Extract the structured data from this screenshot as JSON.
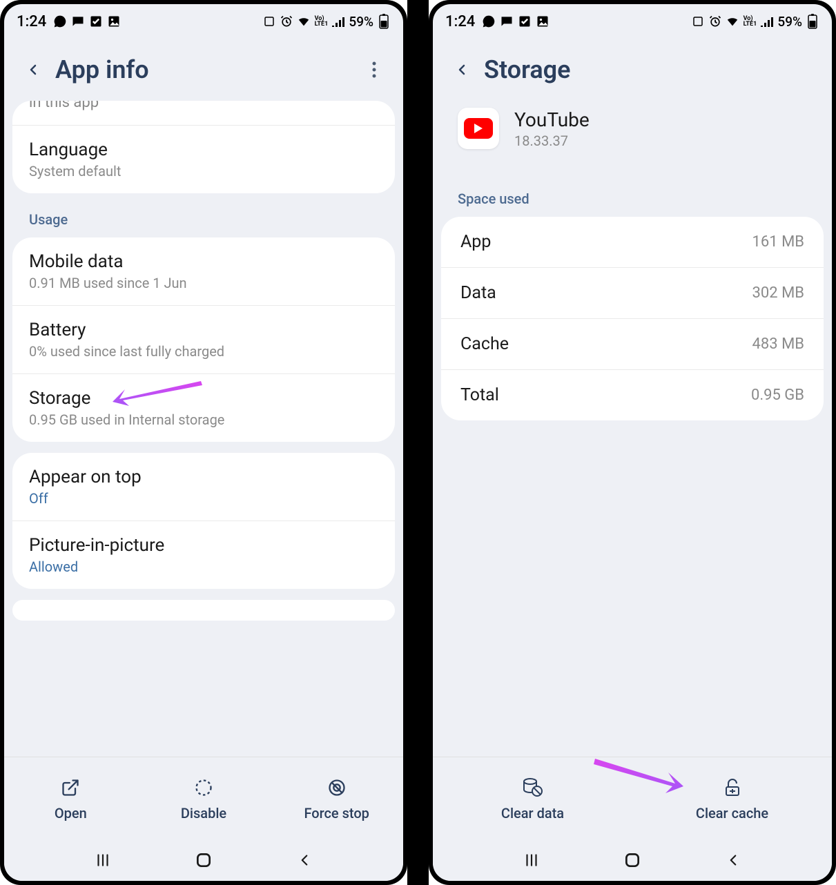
{
  "status": {
    "time": "1:24",
    "battery": "59%"
  },
  "left": {
    "header": "App info",
    "cut_text": "in this app",
    "language": {
      "title": "Language",
      "sub": "System default"
    },
    "usage_label": "Usage",
    "mobile_data": {
      "title": "Mobile data",
      "sub": "0.91 MB used since 1 Jun"
    },
    "battery": {
      "title": "Battery",
      "sub": "0% used since last fully charged"
    },
    "storage": {
      "title": "Storage",
      "sub": "0.95 GB used in Internal storage"
    },
    "appear": {
      "title": "Appear on top",
      "sub": "Off"
    },
    "pip": {
      "title": "Picture-in-picture",
      "sub": "Allowed"
    },
    "buttons": {
      "open": "Open",
      "disable": "Disable",
      "force_stop": "Force stop"
    }
  },
  "right": {
    "header": "Storage",
    "app_name": "YouTube",
    "app_version": "18.33.37",
    "space_label": "Space used",
    "rows": {
      "app": {
        "label": "App",
        "val": "161 MB"
      },
      "data": {
        "label": "Data",
        "val": "302 MB"
      },
      "cache": {
        "label": "Cache",
        "val": "483 MB"
      },
      "total": {
        "label": "Total",
        "val": "0.95 GB"
      }
    },
    "buttons": {
      "clear_data": "Clear data",
      "clear_cache": "Clear cache"
    }
  }
}
